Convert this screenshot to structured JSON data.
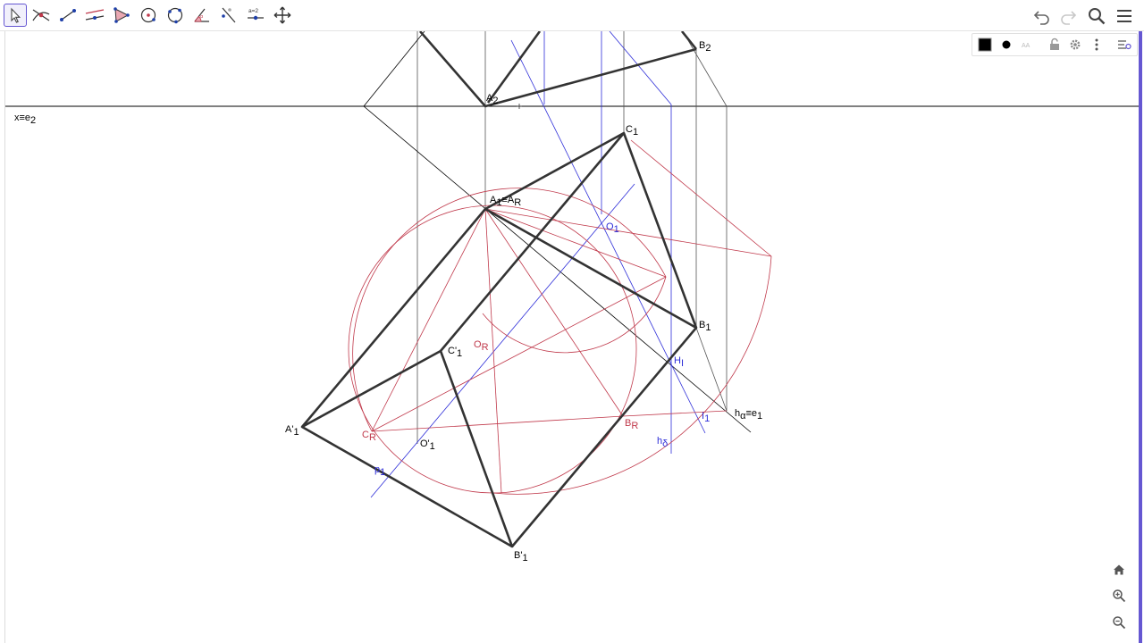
{
  "toolbar": {
    "tools": [
      {
        "name": "Move",
        "icon": "move-arrow-icon",
        "active": true
      },
      {
        "name": "Intersect",
        "icon": "intersect-icon"
      },
      {
        "name": "Segment",
        "icon": "segment-icon"
      },
      {
        "name": "Parallel Line",
        "icon": "parallel-line-icon"
      },
      {
        "name": "Polygon",
        "icon": "polygon-icon"
      },
      {
        "name": "Circle with Center through Point",
        "icon": "circle-center-point-icon"
      },
      {
        "name": "Circle through 3 Points",
        "icon": "circle-three-points-icon"
      },
      {
        "name": "Angle",
        "icon": "angle-icon"
      },
      {
        "name": "Reflect about Line",
        "icon": "reflect-line-icon"
      },
      {
        "name": "Slider",
        "icon": "slider-icon",
        "label": "a=2"
      },
      {
        "name": "Move Graphics View",
        "icon": "move-graphics-icon"
      }
    ],
    "right": [
      {
        "name": "Undo",
        "icon": "undo-icon"
      },
      {
        "name": "Redo",
        "icon": "redo-icon"
      },
      {
        "name": "Search",
        "icon": "search-icon"
      },
      {
        "name": "Menu",
        "icon": "hamburger-menu-icon"
      }
    ]
  },
  "stylebar": {
    "color": "#000000",
    "buttons": [
      "color-swatch-icon",
      "point-style-icon",
      "label-style-icon",
      "lock-icon",
      "settings-gear-icon",
      "more-vert-icon",
      "toggle-stylebar-icon"
    ]
  },
  "labels": {
    "x_e2": {
      "main": "x≡e",
      "sub": "2"
    },
    "A2": {
      "main": "A",
      "sub": "2"
    },
    "B2": {
      "main": "B",
      "sub": "2"
    },
    "C1": {
      "main": "C",
      "sub": "1"
    },
    "A1_AR": {
      "main": "A",
      "sub1": "1",
      "mid": "≡A",
      "sub2": "R"
    },
    "O1": {
      "main": "O",
      "sub": "1"
    },
    "B1": {
      "main": "B",
      "sub": "1"
    },
    "OR": {
      "main": "O",
      "sub": "R"
    },
    "Cp1": {
      "main": "C'",
      "sub": "1"
    },
    "HI": {
      "main": "H",
      "sub": "I"
    },
    "ha_e1": {
      "main": "h",
      "sub1": "α",
      "mid": "≡e",
      "sub2": "1"
    },
    "I1": {
      "main": "I",
      "sub": "1"
    },
    "BR": {
      "main": "B",
      "sub": "R"
    },
    "hd": {
      "main": "h",
      "sub": "δ"
    },
    "Ap1": {
      "main": "A'",
      "sub": "1"
    },
    "CR": {
      "main": "C",
      "sub": "R"
    },
    "Op1": {
      "main": "O'",
      "sub": "1"
    },
    "p1": {
      "main": "p",
      "sub": "1"
    },
    "Bp1": {
      "main": "B'",
      "sub": "1"
    }
  },
  "zoom_controls": [
    "home-icon",
    "zoom-in-icon",
    "zoom-out-icon"
  ],
  "colors": {
    "accent": "#6557d2",
    "black_line": "#000000",
    "thick_line": "#333333",
    "red_line": "#c0394b",
    "blue_line": "#2d2dd8",
    "gray_line": "#555555"
  }
}
